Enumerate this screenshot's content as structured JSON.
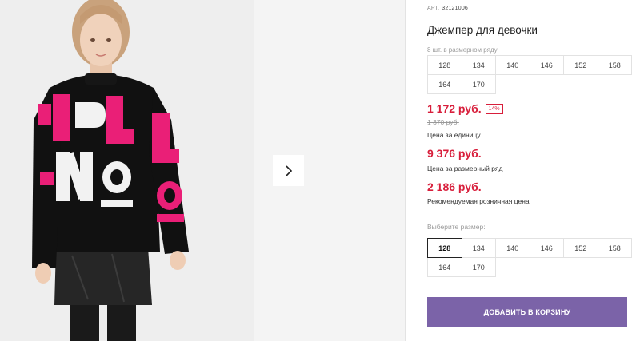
{
  "product": {
    "art_label": "АРТ.",
    "art_value": "32121006",
    "title": "Джемпер для девочки",
    "pack_hint": "8 шт. в размерном ряду"
  },
  "size_row": [
    "128",
    "134",
    "140",
    "146",
    "152",
    "158",
    "164",
    "170"
  ],
  "prices": {
    "unit_price": "1 172 руб.",
    "discount": "14%",
    "old_price": "1 370 руб.",
    "unit_label": "Цена за единицу",
    "row_price": "9 376 руб.",
    "row_label": "Цена за размерный ряд",
    "retail_price": "2 186 руб.",
    "retail_label": "Рекомендуемая розничная цена"
  },
  "size_select": {
    "label": "Выберите размер:",
    "options": [
      "128",
      "134",
      "140",
      "146",
      "152",
      "158",
      "164",
      "170"
    ],
    "selected": "128"
  },
  "cart": {
    "add_label": "ДОБАВИТЬ В КОРЗИНУ"
  },
  "colors": {
    "accent": "#7b63a8",
    "price": "#d81e3b",
    "sweater_pink": "#ea1f77"
  }
}
